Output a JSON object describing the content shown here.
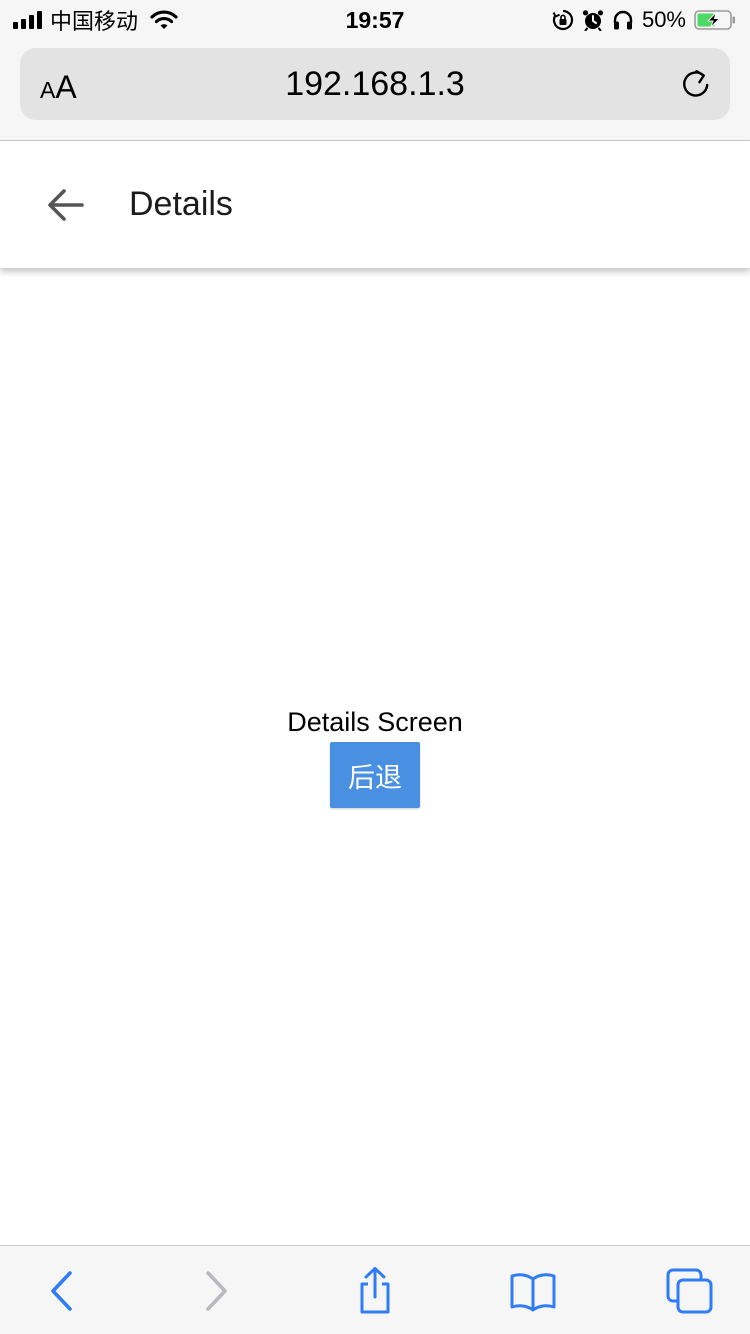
{
  "status_bar": {
    "carrier": "中国移动",
    "time": "19:57",
    "battery_percent": "50%",
    "icons": [
      "signal-icon",
      "wifi-icon",
      "rotation-lock-icon",
      "alarm-icon",
      "headphones-icon",
      "battery-charging-icon"
    ]
  },
  "browser": {
    "text_size_label_small": "A",
    "text_size_label_large": "A",
    "url": "192.168.1.3",
    "reload_icon": "reload-icon"
  },
  "header": {
    "back_icon": "arrow-left-icon",
    "title": "Details"
  },
  "main": {
    "screen_text": "Details Screen",
    "back_button_label": "后退",
    "back_button_color": "#4a90e2"
  },
  "toolbar": {
    "items": [
      "back-icon",
      "forward-icon",
      "share-icon",
      "bookmarks-icon",
      "tabs-icon"
    ],
    "accent_color": "#2f7cf6",
    "disabled_color": "#b8b8bd"
  }
}
